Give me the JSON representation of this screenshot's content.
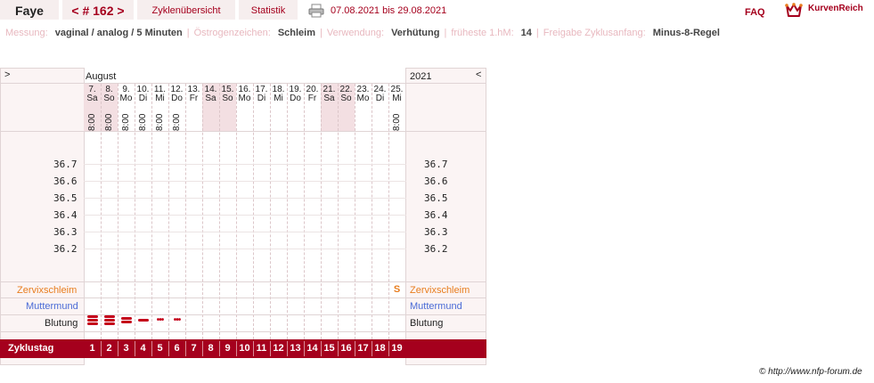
{
  "header": {
    "user": "Faye",
    "cycle_prev": "<",
    "cycle_label": "# 162",
    "cycle_next": ">",
    "tab_overview": "Zyklenübersicht",
    "tab_stats": "Statistik",
    "date_range": "07.08.2021 bis 29.08.2021",
    "faq": "FAQ",
    "brand": "KurvenReich"
  },
  "info": {
    "messung_label": "Messung:",
    "messung_value": "vaginal / analog / 5 Minuten",
    "oestrogen_label": "Östrogenzeichen:",
    "oestrogen_value": "Schleim",
    "verwendung_label": "Verwendung:",
    "verwendung_value": "Verhütung",
    "fruehe_label": "früheste 1.hM:",
    "fruehe_value": "14",
    "freigabe_label": "Freigabe Zyklusanfang:",
    "freigabe_value": "Minus-8-Regel"
  },
  "chart": {
    "nav_left": ">",
    "nav_right": "<",
    "month": "August",
    "year": "2021",
    "days": [
      {
        "num": "7.",
        "wd": "Sa",
        "time": "8:00",
        "weekend": true
      },
      {
        "num": "8.",
        "wd": "So",
        "time": "8:00",
        "weekend": true
      },
      {
        "num": "9.",
        "wd": "Mo",
        "time": "8:00",
        "weekend": false
      },
      {
        "num": "10.",
        "wd": "Di",
        "time": "8:00",
        "weekend": false
      },
      {
        "num": "11.",
        "wd": "Mi",
        "time": "8:00",
        "weekend": false
      },
      {
        "num": "12.",
        "wd": "Do",
        "time": "8:00",
        "weekend": false
      },
      {
        "num": "13.",
        "wd": "Fr",
        "time": "",
        "weekend": false
      },
      {
        "num": "14.",
        "wd": "Sa",
        "time": "",
        "weekend": true
      },
      {
        "num": "15.",
        "wd": "So",
        "time": "",
        "weekend": true
      },
      {
        "num": "16.",
        "wd": "Mo",
        "time": "",
        "weekend": false
      },
      {
        "num": "17.",
        "wd": "Di",
        "time": "",
        "weekend": false
      },
      {
        "num": "18.",
        "wd": "Mi",
        "time": "",
        "weekend": false
      },
      {
        "num": "19.",
        "wd": "Do",
        "time": "",
        "weekend": false
      },
      {
        "num": "20.",
        "wd": "Fr",
        "time": "",
        "weekend": false
      },
      {
        "num": "21.",
        "wd": "Sa",
        "time": "",
        "weekend": true
      },
      {
        "num": "22.",
        "wd": "So",
        "time": "",
        "weekend": true
      },
      {
        "num": "23.",
        "wd": "Mo",
        "time": "",
        "weekend": false
      },
      {
        "num": "24.",
        "wd": "Di",
        "time": "",
        "weekend": false
      },
      {
        "num": "25.",
        "wd": "Mi",
        "time": "8:00",
        "weekend": false
      }
    ],
    "temperatures": [
      "36.7",
      "36.6",
      "36.5",
      "36.4",
      "36.3",
      "36.2"
    ],
    "rows": {
      "zervix": "Zervixschleim",
      "muttermund": "Muttermund",
      "blutung": "Blutung",
      "zyklustag": "Zyklustag"
    },
    "zervix_mark": {
      "day_index": 18,
      "value": "S"
    },
    "bleeding_levels": [
      3,
      3,
      2,
      1,
      0.5,
      0.5,
      0,
      0,
      0,
      0,
      0,
      0,
      0,
      0,
      0,
      0,
      0,
      0,
      0
    ],
    "cycle_days": [
      "1",
      "2",
      "3",
      "4",
      "5",
      "6",
      "7",
      "8",
      "9",
      "10",
      "11",
      "12",
      "13",
      "14",
      "15",
      "16",
      "17",
      "18",
      "19"
    ]
  },
  "footer": {
    "copyright": "© http://www.nfp-forum.de"
  },
  "colors": {
    "accent": "#a5001d",
    "weekend": "#f3dfe2",
    "zervix": "#e87d1e",
    "muttermund": "#4a6bd6",
    "blutung": "#c4001a"
  }
}
